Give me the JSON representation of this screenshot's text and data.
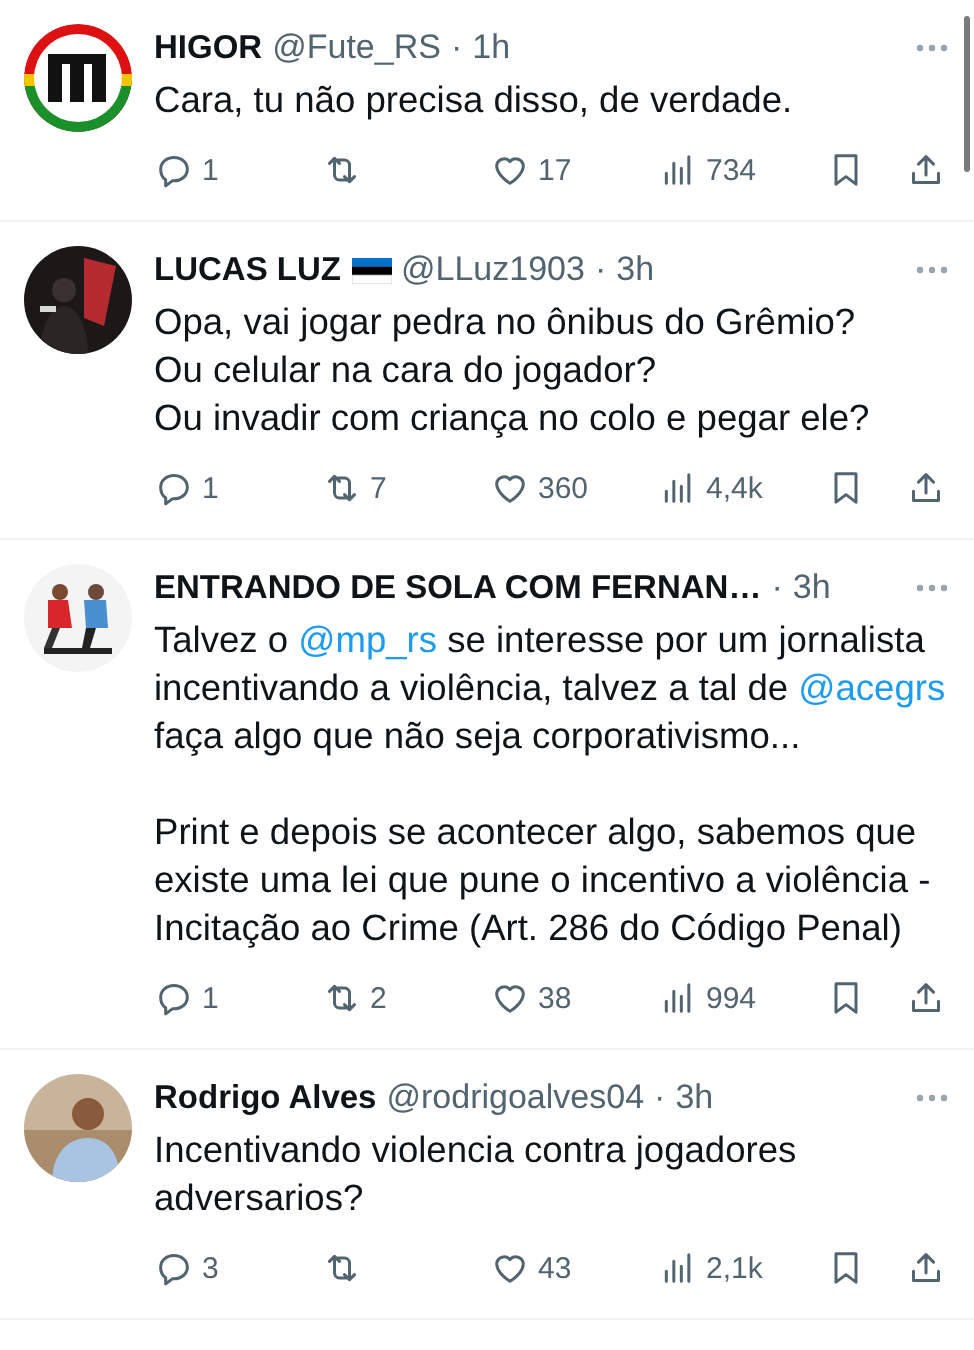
{
  "tweets": [
    {
      "avatar": {
        "kind": "picture"
      },
      "name": "HIGOR",
      "handle": "@Fute_RS",
      "separator": "·",
      "time": "1h",
      "paragraphs": [
        [
          {
            "kind": "text",
            "text": "Cara, tu não precisa disso, de verdade."
          }
        ]
      ],
      "stats": {
        "replies": "1",
        "likes": "17",
        "views": "734"
      }
    },
    {
      "avatar": {
        "kind": "picture"
      },
      "name": "LUCAS LUZ",
      "flag": true,
      "handle": "@LLuz1903",
      "separator": "·",
      "time": "3h",
      "paragraphs": [
        [
          {
            "kind": "text",
            "text": "Opa, vai jogar pedra no ônibus do Grêmio?\nOu celular na cara do jogador?\nOu invadir com criança no colo e pegar ele?"
          }
        ]
      ],
      "stats": {
        "replies": "1",
        "reposts": "7",
        "likes": "360",
        "views": "4,4k"
      }
    },
    {
      "avatar": {
        "kind": "picture"
      },
      "name": "ENTRANDO DE SOLA COM FERNAN…",
      "separator": "·",
      "time": "3h",
      "paragraphs": [
        [
          {
            "kind": "text",
            "text": "Talvez o "
          },
          {
            "kind": "mention",
            "text": "@mp_rs"
          },
          {
            "kind": "text",
            "text": " se interesse por um jornalista incentivando a violência, talvez a tal de "
          },
          {
            "kind": "mention",
            "text": "@acegrs"
          },
          {
            "kind": "text",
            "text": " faça algo que não seja corporativismo..."
          }
        ],
        [
          {
            "kind": "text",
            "text": "Print e depois se acontecer algo, sabemos que existe uma lei que pune o incentivo a violência - Incitação ao Crime (Art. 286 do Código Penal)"
          }
        ]
      ],
      "stats": {
        "replies": "1",
        "reposts": "2",
        "likes": "38",
        "views": "994"
      }
    },
    {
      "avatar": {
        "kind": "picture"
      },
      "name": "Rodrigo Alves",
      "handle": "@rodrigoalves04",
      "separator": "·",
      "time": "3h",
      "paragraphs": [
        [
          {
            "kind": "text",
            "text": "Incentivando violencia contra jogadores adversarios?"
          }
        ]
      ],
      "stats": {
        "replies": "3",
        "likes": "43",
        "views": "2,1k"
      }
    }
  ]
}
